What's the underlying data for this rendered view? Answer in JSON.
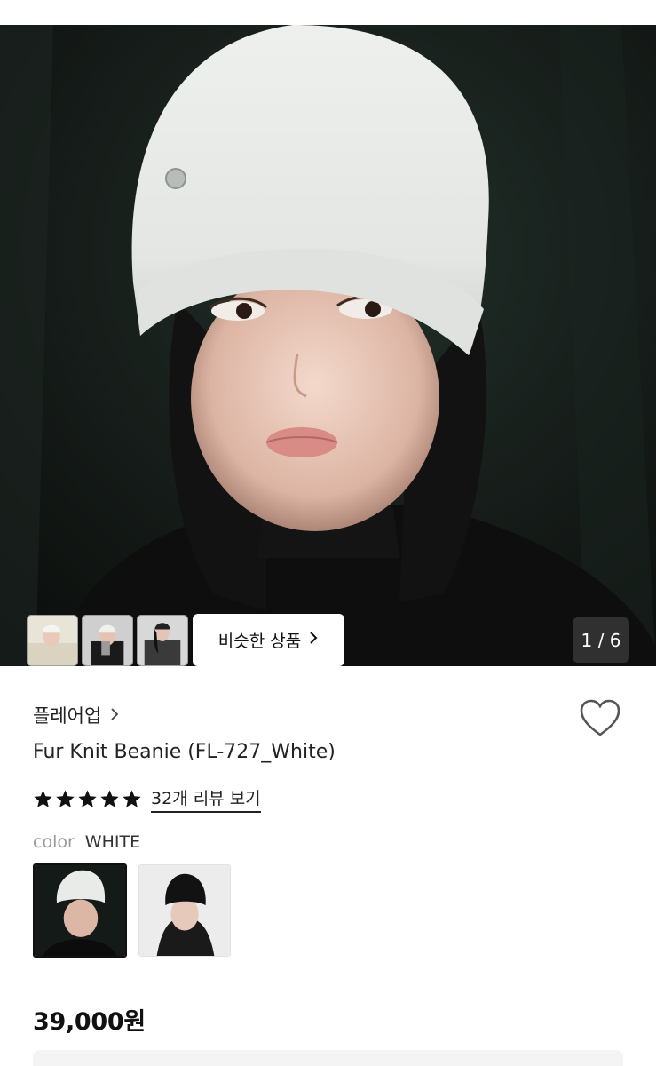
{
  "gallery": {
    "similar_button_label": "비슷한 상품",
    "counter": "1 / 6",
    "thumbnails": [
      "thumb-1",
      "thumb-2",
      "thumb-3"
    ]
  },
  "product": {
    "brand": "플레어업",
    "title": "Fur Knit Beanie (FL-727_White)",
    "rating": 5,
    "review_link": "32개 리뷰 보기",
    "color_label": "color",
    "color_value": "WHITE",
    "price": "39,000원"
  },
  "colors": {
    "accent_text": "#111111",
    "muted_text": "#999999",
    "hero_bg": "#161c19"
  },
  "icons": {
    "heart": "heart-outline-icon",
    "brand_chevron": "chevron-right-icon",
    "star": "star-icon"
  }
}
